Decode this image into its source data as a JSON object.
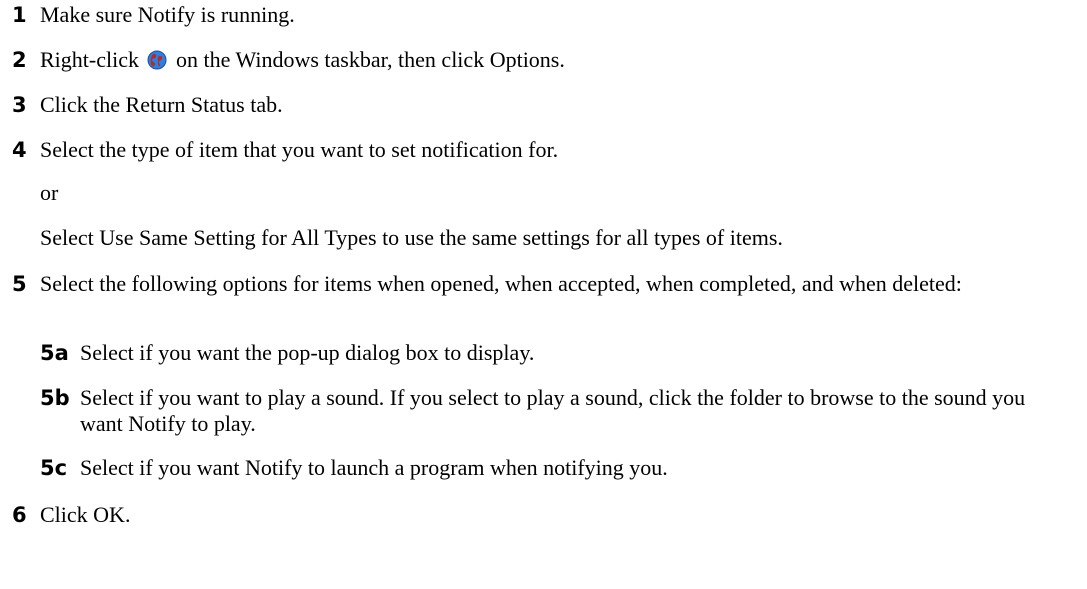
{
  "steps": {
    "s1": {
      "num": "1",
      "text": "Make sure Notify is running."
    },
    "s2": {
      "num": "2",
      "text_before": "Right-click",
      "text_after": "on the Windows taskbar, then click Options."
    },
    "s3": {
      "num": "3",
      "text": "Click the Return Status tab."
    },
    "s4": {
      "num": "4",
      "text": "Select the type of item that you want to set notification for."
    },
    "or": "or",
    "alt": "Select Use Same Setting for All Types to use the same settings for all types of items.",
    "s5": {
      "num": "5",
      "text": "Select the following options for items when opened, when accepted, when completed, and when deleted:"
    },
    "s5a": {
      "num": "5a",
      "text": "Select if you want the pop-up dialog box to display."
    },
    "s5b": {
      "num": "5b",
      "text": "Select if you want to play a sound. If you select to play a sound, click the folder to browse to the sound you want Notify to play."
    },
    "s5c": {
      "num": "5c",
      "text": "Select if you want Notify to launch a program when notifying you."
    },
    "s6": {
      "num": "6",
      "text": "Click OK."
    }
  },
  "icons": {
    "taskbar_icon": "globe-icon"
  }
}
